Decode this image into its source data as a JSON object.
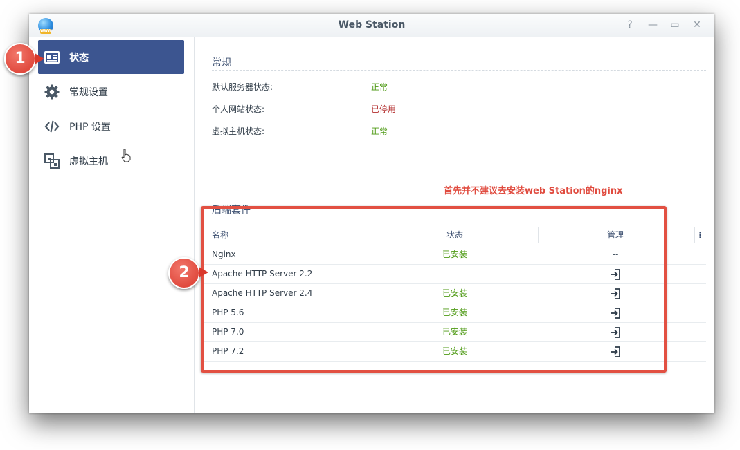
{
  "window": {
    "title": "Web Station",
    "controls": [
      "?",
      "—",
      "▭",
      "✕"
    ]
  },
  "app_icon": {
    "name": "web-station-globe-icon",
    "badge": "WWW"
  },
  "sidebar": {
    "items": [
      {
        "label": "状态",
        "icon": "status-card-icon",
        "active": true
      },
      {
        "label": "常规设置",
        "icon": "gear-icon",
        "active": false
      },
      {
        "label": "PHP 设置",
        "icon": "code-icon",
        "active": false
      },
      {
        "label": "虚拟主机",
        "icon": "virtual-host-icon",
        "active": false
      }
    ]
  },
  "general": {
    "title": "常规",
    "rows": [
      {
        "label": "默认服务器状态:",
        "value": "正常",
        "status": "ok"
      },
      {
        "label": "个人网站状态:",
        "value": "已停用",
        "status": "stopped"
      },
      {
        "label": "虚拟主机状态:",
        "value": "正常",
        "status": "ok"
      }
    ]
  },
  "annotation": {
    "note": "首先并不建议去安装web Station的nginx",
    "callouts": [
      "1",
      "2"
    ]
  },
  "backend": {
    "title": "后端套件",
    "columns": [
      "名称",
      "状态",
      "管理"
    ],
    "more_icon": "⋮",
    "rows": [
      {
        "name": "Nginx",
        "status": "已安装",
        "manage": "--",
        "has_manage_icon": false
      },
      {
        "name": "Apache HTTP Server 2.2",
        "status": "--",
        "manage": "",
        "has_manage_icon": true
      },
      {
        "name": "Apache HTTP Server 2.4",
        "status": "已安装",
        "manage": "",
        "has_manage_icon": true
      },
      {
        "name": "PHP 5.6",
        "status": "已安装",
        "manage": "",
        "has_manage_icon": true
      },
      {
        "name": "PHP 7.0",
        "status": "已安装",
        "manage": "",
        "has_manage_icon": true
      },
      {
        "name": "PHP 7.2",
        "status": "已安装",
        "manage": "",
        "has_manage_icon": true
      }
    ]
  },
  "colors": {
    "sidebar_active": "#3c5590",
    "ok": "#4e9a14",
    "stopped": "#b32d2d",
    "annotation": "#e25042"
  }
}
